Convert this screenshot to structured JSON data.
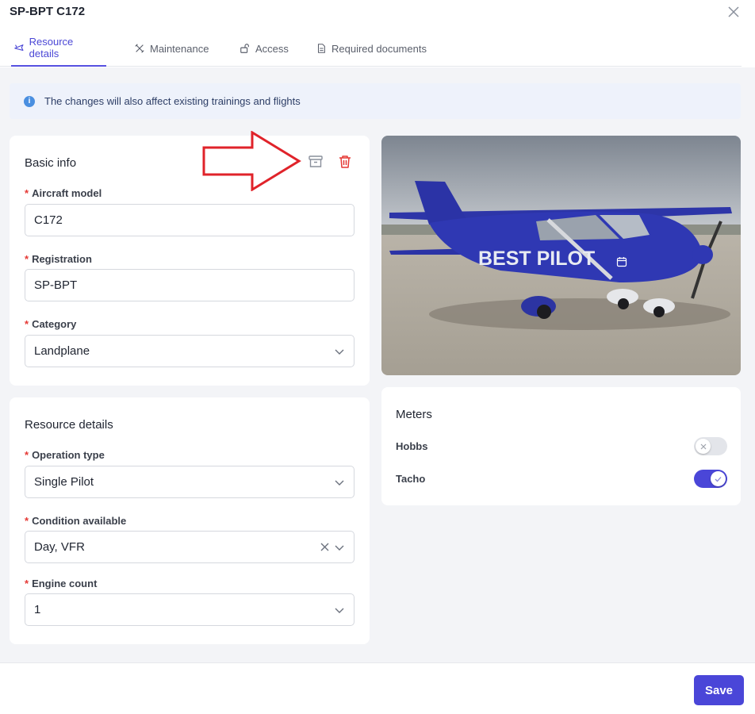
{
  "header": {
    "title": "SP-BPT C172",
    "close_icon": "close-icon"
  },
  "tabs": [
    {
      "label": "Resource details",
      "icon": "airplane-icon",
      "active": true
    },
    {
      "label": "Maintenance",
      "icon": "tools-icon",
      "active": false
    },
    {
      "label": "Access",
      "icon": "unlock-icon",
      "active": false
    },
    {
      "label": "Required documents",
      "icon": "document-icon",
      "active": false
    }
  ],
  "banner": {
    "icon": "info-icon",
    "text": "The changes will also affect existing trainings and flights"
  },
  "basic_info": {
    "title": "Basic info",
    "archive_icon": "archive-icon",
    "delete_icon": "trash-icon",
    "aircraft_model": {
      "label": "Aircraft model",
      "value": "C172"
    },
    "registration": {
      "label": "Registration",
      "value": "SP-BPT"
    },
    "category": {
      "label": "Category",
      "value": "Landplane"
    }
  },
  "resource_details": {
    "title": "Resource details",
    "operation_type": {
      "label": "Operation type",
      "value": "Single Pilot"
    },
    "condition_available": {
      "label": "Condition available",
      "value": "Day, VFR"
    },
    "engine_count": {
      "label": "Engine count",
      "value": "1"
    }
  },
  "photo": {
    "livery_text": "BEST PILOT"
  },
  "meters": {
    "title": "Meters",
    "items": [
      {
        "label": "Hobbs",
        "enabled": false
      },
      {
        "label": "Tacho",
        "enabled": true
      }
    ]
  },
  "footer": {
    "save_label": "Save"
  },
  "colors": {
    "accent": "#4a46d8",
    "danger": "#e53935",
    "annotation_arrow": "#e0232a"
  }
}
